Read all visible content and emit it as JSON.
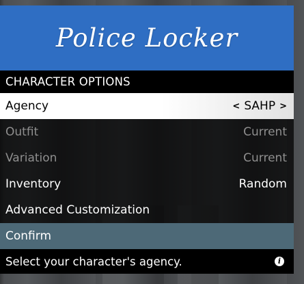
{
  "banner": {
    "title": "Police Locker"
  },
  "subheader": {
    "title": "CHARACTER OPTIONS"
  },
  "items": [
    {
      "label": "Agency",
      "value": "SAHP"
    },
    {
      "label": "Outfit",
      "value": "Current"
    },
    {
      "label": "Variation",
      "value": "Current"
    },
    {
      "label": "Inventory",
      "value": "Random"
    },
    {
      "label": "Advanced Customization"
    },
    {
      "label": "Confirm"
    }
  ],
  "description": {
    "text": "Select your character's agency."
  },
  "colors": {
    "banner": "#2f6ec3",
    "selected": "#ffffff",
    "confirm": "#4d6977"
  },
  "icons": {
    "left_arrow": "<",
    "right_arrow": ">",
    "info": "i"
  }
}
